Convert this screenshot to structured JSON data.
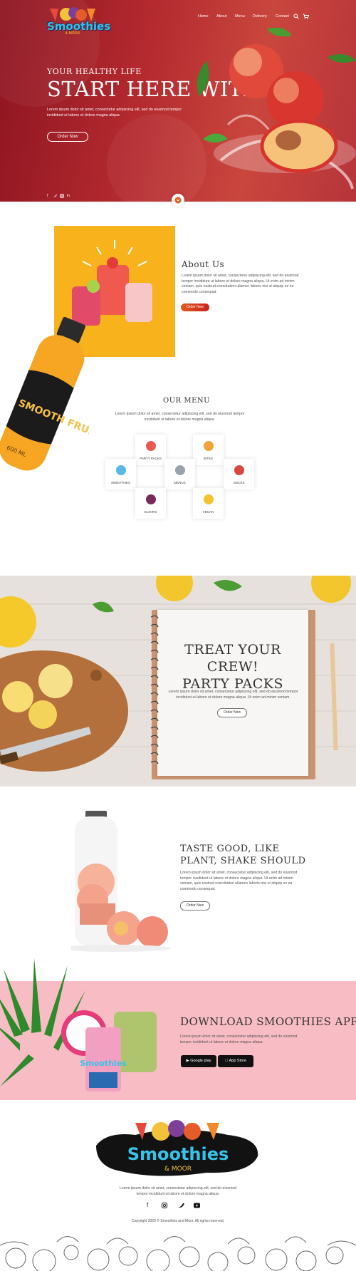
{
  "brand": {
    "name": "Smoothies",
    "tagline": "& MOOR"
  },
  "nav": [
    "Home",
    "About",
    "Menu",
    "Delivery",
    "Contact"
  ],
  "hero": {
    "eyebrow": "YOUR HEALTHY LIFE",
    "title": "START HERE WITH US",
    "text": "Lorem ipsum dolor sit amet, consectetur adipiscing elit, sed do eiusmod tempor incididunt ut labore et dolore magna aliqua.",
    "cta": "Order Now"
  },
  "about": {
    "title": "About Us",
    "text": "Lorem ipsum dolor sit amet, consectetur adipiscing elit, sed do eiusmod tempor incididunt ut labore et dolore magna aliqua. Ut enim ad minim veniam, quis nostrud exercitation ullamco laboris nisi ut aliquip ex ea commodo consequat.",
    "cta": "Order Now",
    "bottle_label": "SMOOTH FRUIT",
    "bottle_size": "600 ML"
  },
  "menu": {
    "title": "OUR MENU",
    "text": "Lorem ipsum dolor sit amet, consectetur adipiscing elit, sed do eiusmod tempor incididunt ut labore et dolore magna aliqua.",
    "items": [
      {
        "label": "PARTY PACKS",
        "color": "#e85a4f"
      },
      {
        "label": "BITES",
        "color": "#f2a33a"
      },
      {
        "label": "SMOOTHIES",
        "color": "#58b9e6"
      },
      {
        "label": "MENUS",
        "color": "#9aa3ad"
      },
      {
        "label": "JUICES",
        "color": "#d9463b"
      },
      {
        "label": "ELIXIRS",
        "color": "#7a2a5a"
      },
      {
        "label": "VEGAN",
        "color": "#f4c430"
      }
    ]
  },
  "party": {
    "title_line1": "TREAT YOUR CREW!",
    "title_line2": "PARTY PACKS",
    "text": "Lorem ipsum dolor sit amet, consectetur adipiscing elit, sed do eiusmod tempor incididunt ut labore et dolore magna aliqua. Ut enim ad minim veniam.",
    "cta": "Order Now"
  },
  "taste": {
    "title_line1": "TASTE GOOD, LIKE",
    "title_line2": "PLANT, SHAKE SHOULD",
    "text": "Lorem ipsum dolor sit amet, consectetur adipiscing elit, sed do eiusmod tempor incididunt ut labore et dolore magna aliqua. Ut enim ad minim veniam, quis nostrud exercitation ullamco laboris nisi ut aliquip ex ea commodo consequat.",
    "cta": "Order Now"
  },
  "app": {
    "title": "DOWNLOAD SMOOTHIES APP",
    "text": "Lorem ipsum dolor sit amet, consectetur adipiscing elit, sed do eiusmod tempor incididunt ut labore et dolore magna aliqua.",
    "google": "Google play",
    "apple": "App Store"
  },
  "footer": {
    "text": "Lorem ipsum dolor sit amet, consectetur adipiscing elit, sed do eiusmod tempor incididunt ut labore et dolore magna aliqua.",
    "copyright": "Copyright 2020 © Smoothies and Moor. All rights reserved."
  },
  "colors": {
    "hero_red": "#b42a2f",
    "accent_orange": "#e35a1d",
    "app_pink": "#f8bcc4",
    "menu_yellow": "#f7b21c"
  },
  "icons": [
    "search-icon",
    "cart-icon",
    "facebook-icon",
    "twitter-icon",
    "instagram-icon",
    "linkedin-icon",
    "scroll-down-icon",
    "youtube-icon"
  ]
}
